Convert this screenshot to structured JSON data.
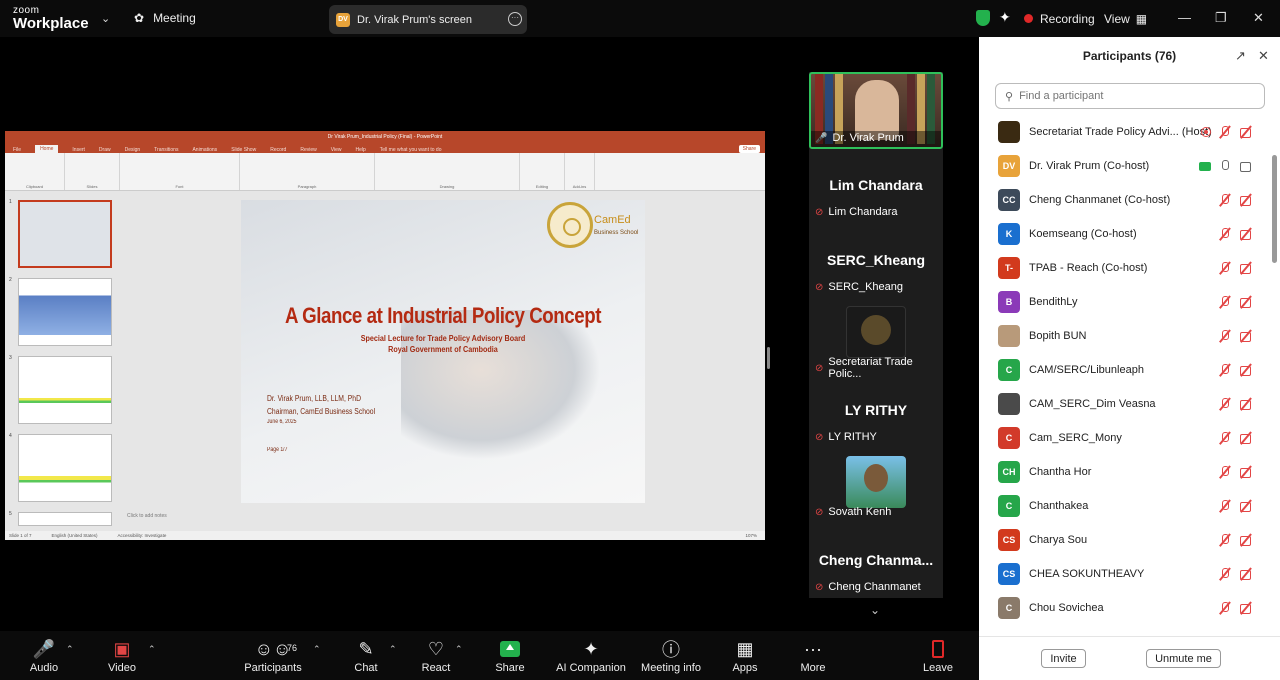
{
  "window": {
    "logo_top": "zoom",
    "logo_bottom": "Workplace",
    "meeting_label": "Meeting",
    "screen_badge": "DV",
    "screen_label": "Dr. Virak Prum's screen",
    "recording_label": "Recording",
    "view_label": "View"
  },
  "shared_screen": {
    "ppt_title": "Dr Virak Prum_Industrial Policy (Final) - PowerPoint",
    "ppt_tabs": [
      "File",
      "Home",
      "Insert",
      "Draw",
      "Design",
      "Transitions",
      "Animations",
      "Slide Show",
      "Record",
      "Review",
      "View",
      "Help"
    ],
    "ppt_search": "Tell me what you want to do",
    "ppt_share": "Share",
    "ribbon_groups": [
      "Clipboard",
      "Slides",
      "Font",
      "Paragraph",
      "Drawing",
      "Editing",
      "Add-ins"
    ],
    "thumb_numbers": [
      "1",
      "2",
      "3",
      "4",
      "5"
    ],
    "slide": {
      "title": "A Glance at Industrial Policy Concept",
      "subtitle1": "Special Lecture for Trade Policy Advisory Board",
      "subtitle2": "Royal Government of Cambodia",
      "author": "Dr. Virak Prum, LLB, LLM, PhD",
      "chairman": "Chairman, CamEd Business School",
      "date": "June 6, 2025",
      "page": "Page 1/7",
      "logo_text": "CamEd",
      "logo_sub": "Business School"
    },
    "notes": "Click to add notes",
    "status_slide": "Slide 1 of 7",
    "status_lang": "English (United States)",
    "status_access": "Accessibility: Investigate",
    "status_zoom": "107%"
  },
  "gallery": {
    "self_name": "Dr. Virak Prum",
    "tiles": [
      {
        "big": "Lim Chandara",
        "small": "Lim Chandara"
      },
      {
        "big": "SERC_Kheang",
        "small": "SERC_Kheang"
      },
      {
        "big": "",
        "small": "Secretariat Trade Polic..."
      },
      {
        "big": "LY RITHY",
        "small": "LY RITHY"
      },
      {
        "big": "",
        "small": "Sovath Kenh"
      },
      {
        "big": "Cheng  Chanma...",
        "small": "Cheng Chanmanet"
      }
    ]
  },
  "panel": {
    "title": "Participants (76)",
    "search_placeholder": "Find a participant",
    "participants": [
      {
        "initials": "",
        "color": "#3a2a12",
        "name": "Secretariat Trade Policy Advi...  (Host)"
      },
      {
        "initials": "DV",
        "color": "#e8a33a",
        "name": "Dr. Virak Prum (Co-host)"
      },
      {
        "initials": "CC",
        "color": "#3d4a5a",
        "name": "Cheng Chanmanet (Co-host)"
      },
      {
        "initials": "K",
        "color": "#1a6fcf",
        "name": "Koemseang (Co-host)"
      },
      {
        "initials": "T-",
        "color": "#d23a1d",
        "name": "TPAB - Reach (Co-host)"
      },
      {
        "initials": "B",
        "color": "#8b3ab8",
        "name": "BendithLy"
      },
      {
        "initials": "",
        "color": "#b89a7a",
        "name": "Bopith BUN"
      },
      {
        "initials": "C",
        "color": "#26a64a",
        "name": "CAM/SERC/Libunleaph"
      },
      {
        "initials": "",
        "color": "#4a4a4a",
        "name": "CAM_SERC_Dim Veasna"
      },
      {
        "initials": "C",
        "color": "#d23a2a",
        "name": "Cam_SERC_Mony"
      },
      {
        "initials": "CH",
        "color": "#26a64a",
        "name": "Chantha Hor"
      },
      {
        "initials": "C",
        "color": "#26a64a",
        "name": "Chanthakea"
      },
      {
        "initials": "CS",
        "color": "#d23a1d",
        "name": "Charya Sou"
      },
      {
        "initials": "CS",
        "color": "#1a6fcf",
        "name": "CHEA SOKUNTHEAVY"
      },
      {
        "initials": "C",
        "color": "#8a7a6a",
        "name": "Chou Sovichea"
      }
    ],
    "invite_label": "Invite",
    "unmute_label": "Unmute me"
  },
  "toolbar": {
    "audio": "Audio",
    "video": "Video",
    "participants": "Participants",
    "participants_count": "76",
    "chat": "Chat",
    "react": "React",
    "share": "Share",
    "ai": "AI Companion",
    "info": "Meeting info",
    "apps": "Apps",
    "more": "More",
    "leave": "Leave"
  }
}
